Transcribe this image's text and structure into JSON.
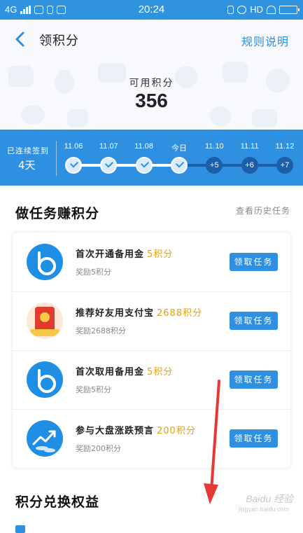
{
  "status_bar": {
    "network": "4G",
    "time": "20:24",
    "hd": "HD"
  },
  "header": {
    "title": "领积分",
    "rules_link": "规则说明",
    "points_label": "可用积分",
    "points_value": "356"
  },
  "streak": {
    "label": "已连续签到",
    "days": "4天",
    "dates": [
      "11.06",
      "11.07",
      "11.08",
      "今日",
      "11.10",
      "11.11",
      "11.12"
    ],
    "rewards": [
      "",
      "",
      "",
      "",
      "+5",
      "+6",
      "+7"
    ],
    "checked_count": 4
  },
  "tasks_section": {
    "title": "做任务赚积分",
    "history_link": "查看历史任务",
    "tasks": [
      {
        "name": "首次开通备用金",
        "bonus": "5积分",
        "reward": "奖励5积分",
        "button": "领取任务",
        "icon": "beiyongjin-b-icon"
      },
      {
        "name": "推荐好友用支付宝",
        "bonus": "2688积分",
        "reward": "奖励2688积分",
        "button": "领取任务",
        "icon": "red-envelope-icon"
      },
      {
        "name": "首次取用备用金",
        "bonus": "5积分",
        "reward": "奖励5积分",
        "button": "领取任务",
        "icon": "beiyongjin-b-icon"
      },
      {
        "name": "参与大盘涨跌预言",
        "bonus": "200积分",
        "reward": "奖励200积分",
        "button": "领取任务",
        "icon": "trend-chart-icon"
      }
    ]
  },
  "exchange_section": {
    "title": "积分兑换权益"
  },
  "watermark": {
    "brand": "Baidu 经验",
    "url": "jingyan.baidu.com"
  },
  "colors": {
    "accent": "#2f8fe0",
    "bonus": "#e4a010",
    "annotation_arrow": "#e53935"
  }
}
